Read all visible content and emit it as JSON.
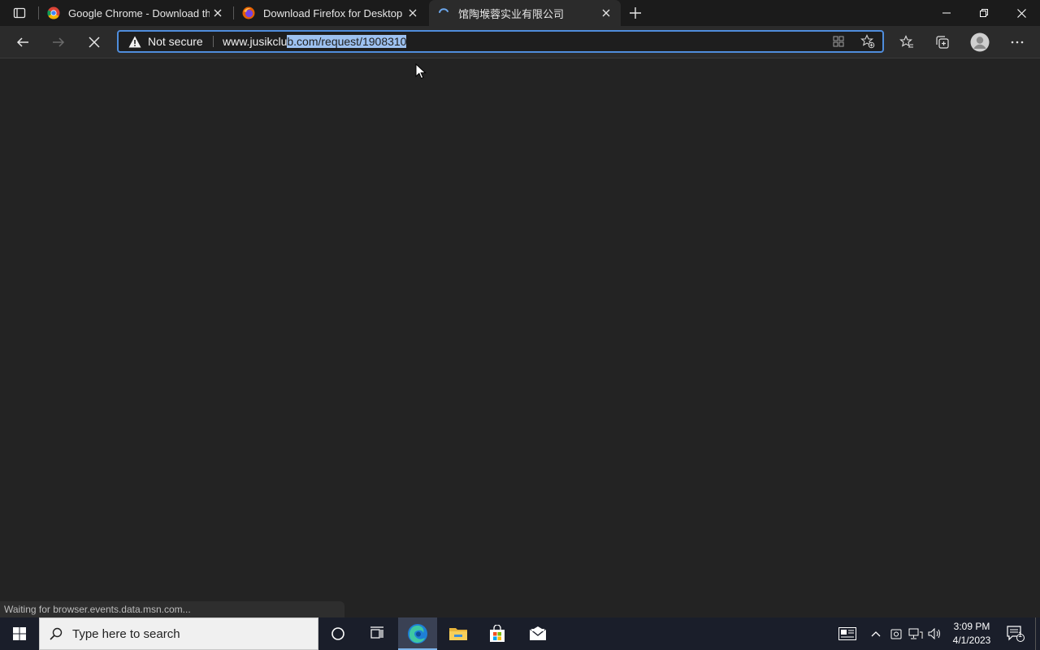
{
  "browser": {
    "tabs": [
      {
        "title": "Google Chrome - Download the",
        "favicon": "chrome-favicon",
        "active": false
      },
      {
        "title": "Download Firefox for Desktop —",
        "favicon": "firefox-favicon",
        "active": false
      },
      {
        "title": "馆陶堠蓉实业有限公司",
        "favicon": "loading-spinner",
        "active": true
      }
    ],
    "address_bar": {
      "security_label": "Not secure",
      "url_plain": "www.jusikclu",
      "url_selected": "b.com/request/1908310"
    },
    "status_text": "Waiting for browser.events.data.msn.com...",
    "accent_color": "#4f8ddc"
  },
  "taskbar": {
    "search_placeholder": "Type here to search",
    "time": "3:09 PM",
    "date": "4/1/2023",
    "notification_count": "1",
    "pinned": [
      "task-view-icon",
      "edge-icon",
      "file-explorer-icon",
      "store-icon",
      "mail-icon"
    ]
  }
}
